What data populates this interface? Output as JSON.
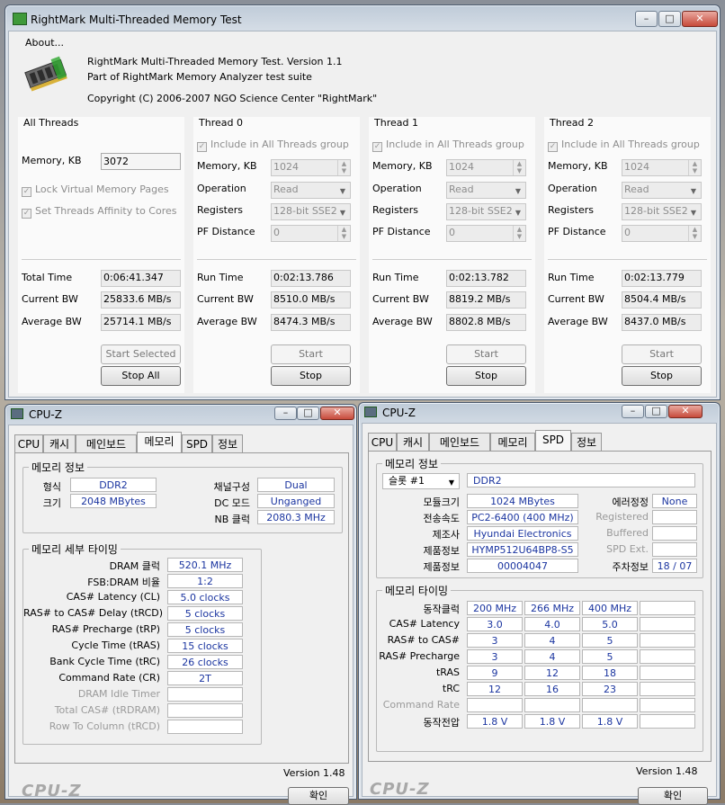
{
  "rm": {
    "title": "RightMark Multi-Threaded Memory Test",
    "about_label": "About...",
    "about_lines": [
      "RightMark Multi-Threaded Memory Test. Version 1.1",
      "Part of RightMark Memory Analyzer test suite",
      "Copyright (C) 2006-2007 NGO Science Center \"RightMark\""
    ],
    "all": {
      "title": "All Threads",
      "memory_label": "Memory, KB",
      "memory_value": "3072",
      "lock_label": "Lock Virtual Memory Pages",
      "affinity_label": "Set Threads Affinity to Cores",
      "total_time_label": "Total Time",
      "total_time": "0:06:41.347",
      "current_bw_label": "Current BW",
      "current_bw": "25833.6 MB/s",
      "average_bw_label": "Average BW",
      "average_bw": "25714.1 MB/s",
      "start_selected": "Start Selected",
      "stop_all": "Stop All"
    },
    "threads": [
      {
        "title": "Thread 0",
        "include": "Include in All Threads group",
        "memory_label": "Memory, KB",
        "memory": "1024",
        "operation_label": "Operation",
        "operation": "Read",
        "registers_label": "Registers",
        "registers": "128-bit SSE2",
        "pf_label": "PF Distance",
        "pf": "0",
        "run_time_label": "Run Time",
        "run_time": "0:02:13.786",
        "current_bw_label": "Current BW",
        "current_bw": "8510.0 MB/s",
        "average_bw_label": "Average BW",
        "average_bw": "8474.3 MB/s",
        "start": "Start",
        "stop": "Stop"
      },
      {
        "title": "Thread 1",
        "include": "Include in All Threads group",
        "memory_label": "Memory, KB",
        "memory": "1024",
        "operation_label": "Operation",
        "operation": "Read",
        "registers_label": "Registers",
        "registers": "128-bit SSE2",
        "pf_label": "PF Distance",
        "pf": "0",
        "run_time_label": "Run Time",
        "run_time": "0:02:13.782",
        "current_bw_label": "Current BW",
        "current_bw": "8819.2 MB/s",
        "average_bw_label": "Average BW",
        "average_bw": "8802.8 MB/s",
        "start": "Start",
        "stop": "Stop"
      },
      {
        "title": "Thread 2",
        "include": "Include in All Threads group",
        "memory_label": "Memory, KB",
        "memory": "1024",
        "operation_label": "Operation",
        "operation": "Read",
        "registers_label": "Registers",
        "registers": "128-bit SSE2",
        "pf_label": "PF Distance",
        "pf": "0",
        "run_time_label": "Run Time",
        "run_time": "0:02:13.779",
        "current_bw_label": "Current BW",
        "current_bw": "8504.4 MB/s",
        "average_bw_label": "Average BW",
        "average_bw": "8437.0 MB/s",
        "start": "Start",
        "stop": "Stop"
      }
    ]
  },
  "cpuz_left": {
    "title": "CPU-Z",
    "tabs": [
      "CPU",
      "캐시",
      "메인보드",
      "메모리",
      "SPD",
      "정보"
    ],
    "active_tab": "메모리",
    "general_title": "메모리 정보",
    "type_label": "형식",
    "type": "DDR2",
    "size_label": "크기",
    "size": "2048 MBytes",
    "channels_label": "채널구성",
    "channels": "Dual",
    "dc_label": "DC 모드",
    "dc": "Unganged",
    "nb_label": "NB 클럭",
    "nb": "2080.3 MHz",
    "timings_title": "메모리 세부 타이밍",
    "timings": [
      {
        "label": "DRAM 클럭",
        "value": "520.1 MHz"
      },
      {
        "label": "FSB:DRAM 비율",
        "value": "1:2"
      },
      {
        "label": "CAS# Latency (CL)",
        "value": "5.0 clocks"
      },
      {
        "label": "RAS# to CAS# Delay (tRCD)",
        "value": "5 clocks"
      },
      {
        "label": "RAS# Precharge (tRP)",
        "value": "5 clocks"
      },
      {
        "label": "Cycle Time (tRAS)",
        "value": "15 clocks"
      },
      {
        "label": "Bank Cycle Time (tRC)",
        "value": "26 clocks"
      },
      {
        "label": "Command Rate (CR)",
        "value": "2T"
      },
      {
        "label": "DRAM Idle Timer",
        "value": ""
      },
      {
        "label": "Total CAS# (tRDRAM)",
        "value": ""
      },
      {
        "label": "Row To Column (tRCD)",
        "value": ""
      }
    ],
    "version": "Version 1.48",
    "logo": "CPU-Z",
    "ok": "확인"
  },
  "cpuz_right": {
    "title": "CPU-Z",
    "tabs": [
      "CPU",
      "캐시",
      "메인보드",
      "메모리",
      "SPD",
      "정보"
    ],
    "active_tab": "SPD",
    "slot_title": "메모리 정보",
    "slot_select": "슬롯 #1",
    "slot_type": "DDR2",
    "info": [
      {
        "label": "모듈크기",
        "value": "1024 MBytes"
      },
      {
        "label": "전송속도",
        "value": "PC2-6400 (400 MHz)"
      },
      {
        "label": "제조사",
        "value": "Hyundai Electronics"
      },
      {
        "label": "제품정보",
        "value": "HYMP512U64BP8-S5"
      },
      {
        "label": "제품정보",
        "value": "00004047"
      }
    ],
    "right_info": [
      {
        "label": "에러정정",
        "value": "None",
        "dim": false
      },
      {
        "label": "Registered",
        "value": "",
        "dim": true
      },
      {
        "label": "Buffered",
        "value": "",
        "dim": true
      },
      {
        "label": "SPD Ext.",
        "value": "",
        "dim": true
      },
      {
        "label": "주차정보",
        "value": "18 / 07",
        "dim": false
      }
    ],
    "timing_title": "메모리 타이밍",
    "timing_rows": [
      {
        "label": "동작클럭",
        "vals": [
          "200 MHz",
          "266 MHz",
          "400 MHz",
          ""
        ],
        "dim": false
      },
      {
        "label": "CAS# Latency",
        "vals": [
          "3.0",
          "4.0",
          "5.0",
          ""
        ],
        "dim": false
      },
      {
        "label": "RAS# to CAS#",
        "vals": [
          "3",
          "4",
          "5",
          ""
        ],
        "dim": false
      },
      {
        "label": "RAS# Precharge",
        "vals": [
          "3",
          "4",
          "5",
          ""
        ],
        "dim": false
      },
      {
        "label": "tRAS",
        "vals": [
          "9",
          "12",
          "18",
          ""
        ],
        "dim": false
      },
      {
        "label": "tRC",
        "vals": [
          "12",
          "16",
          "23",
          ""
        ],
        "dim": false
      },
      {
        "label": "Command Rate",
        "vals": [
          "",
          "",
          "",
          ""
        ],
        "dim": true
      },
      {
        "label": "동작전압",
        "vals": [
          "1.8 V",
          "1.8 V",
          "1.8 V",
          ""
        ],
        "dim": false
      }
    ],
    "version": "Version 1.48",
    "logo": "CPU-Z",
    "ok": "확인"
  },
  "colors": {
    "value_blue": "#1b35a0",
    "titlebar": "#c3d0dd"
  },
  "icons": [
    "memory-chip-icon",
    "cpuz-icon",
    "minimize-icon",
    "maximize-icon",
    "close-icon",
    "spin-up-icon",
    "spin-down-icon",
    "dropdown-arrow-icon",
    "checkbox-checked-icon"
  ]
}
